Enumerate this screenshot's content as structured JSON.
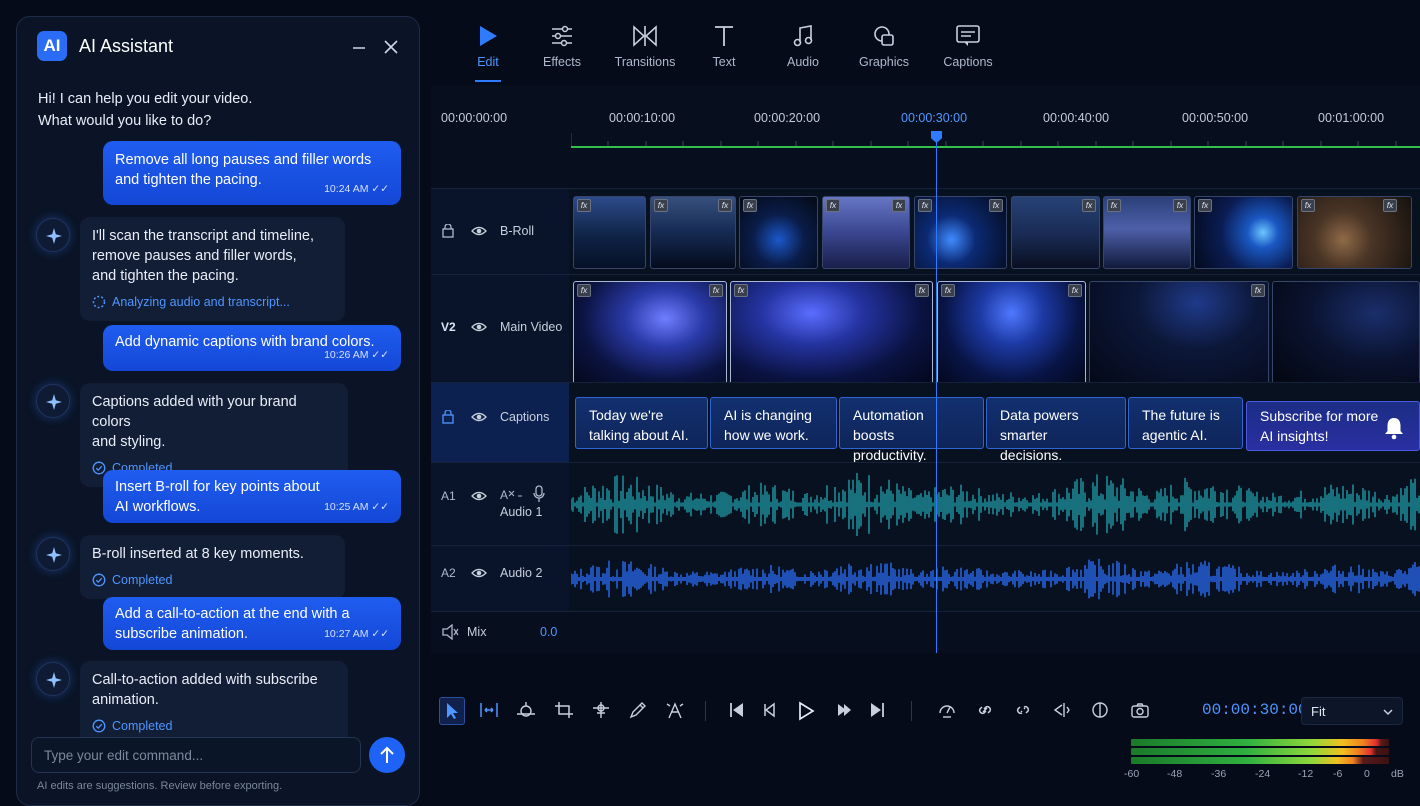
{
  "ai_panel": {
    "logo": "AI",
    "title": "AI Assistant",
    "greeting": [
      "Hi! I can help you edit your video.",
      "What would you like to do?"
    ],
    "messages": [
      {
        "role": "user",
        "lines": [
          "Remove all long pauses and filler words",
          "and tighten the pacing."
        ],
        "time": "10:24 AM"
      },
      {
        "role": "assistant",
        "lines": [
          "I'll scan the transcript and timeline,",
          "remove pauses and filler words,",
          "and tighten the pacing."
        ],
        "status": "Analyzing audio and transcript..."
      },
      {
        "role": "user",
        "lines": [
          "Add dynamic captions with brand colors."
        ],
        "time": "10:26 AM"
      },
      {
        "role": "assistant",
        "lines": [
          "Captions added with your brand colors",
          "and styling."
        ],
        "status": "Completed"
      },
      {
        "role": "user",
        "lines": [
          "Insert B-roll for key points about",
          "AI workflows."
        ],
        "time": "10:25 AM"
      },
      {
        "role": "assistant",
        "lines": [
          "B-roll inserted at 8 key moments."
        ],
        "status": "Completed"
      },
      {
        "role": "user",
        "lines": [
          "Add a call-to-action at the end with a",
          "subscribe animation."
        ],
        "time": "10:27 AM"
      },
      {
        "role": "assistant",
        "lines": [
          "Call-to-action added with subscribe",
          "animation."
        ],
        "status": "Completed"
      }
    ],
    "input_placeholder": "Type your edit command...",
    "disclaimer": "AI edits are suggestions. Review before exporting."
  },
  "toolbar": {
    "tabs": [
      {
        "label": "Edit",
        "icon": "play-icon",
        "active": true
      },
      {
        "label": "Effects",
        "icon": "sliders-icon"
      },
      {
        "label": "Transitions",
        "icon": "transition-icon"
      },
      {
        "label": "Text",
        "icon": "text-icon"
      },
      {
        "label": "Audio",
        "icon": "music-note-icon"
      },
      {
        "label": "Graphics",
        "icon": "shapes-icon"
      },
      {
        "label": "Captions",
        "icon": "caption-icon"
      }
    ]
  },
  "timeline": {
    "ruler": [
      "00:00:00:00",
      "00:00:10:00",
      "00:00:20:00",
      "00:00:30:00",
      "00:00:40:00",
      "00:00:50:00",
      "00:01:00:00"
    ],
    "current_ruler_label": "00:00:30:00",
    "tracks": {
      "broll": {
        "id": "V3",
        "label": "B-Roll"
      },
      "main": {
        "id": "V2",
        "label": "Main Video"
      },
      "captions": {
        "id": "V1",
        "label": "Captions"
      },
      "audio1": {
        "id": "A1",
        "label": "Audio 1"
      },
      "audio2": {
        "id": "A2",
        "label": "Audio 2"
      },
      "mix": {
        "label": "Mix",
        "value": "0.0"
      }
    },
    "captions": [
      {
        "lines": [
          "Today we're",
          "talking about AI."
        ]
      },
      {
        "lines": [
          "AI is changing",
          "how we work."
        ]
      },
      {
        "lines": [
          "Automation",
          "boosts productivity."
        ]
      },
      {
        "lines": [
          "Data powers",
          "smarter decisions."
        ]
      },
      {
        "lines": [
          "The future is",
          "agentic AI."
        ]
      },
      {
        "lines": [
          "Subscribe for more",
          "AI insights!"
        ]
      }
    ],
    "fx_label": "fx"
  },
  "transport": {
    "timecode": "00:00:30:00",
    "zoom": "Fit",
    "meter_scale": [
      "-60",
      "-48",
      "-36",
      "-24",
      "-12",
      "-6",
      "0",
      "dB"
    ]
  },
  "colors": {
    "accent": "#2f7bff",
    "user_bubble": "#1a52e6",
    "timeline_green": "#33c04a",
    "waveform_a1": "#1f9aa6",
    "waveform_a2": "#2a6cf5"
  }
}
